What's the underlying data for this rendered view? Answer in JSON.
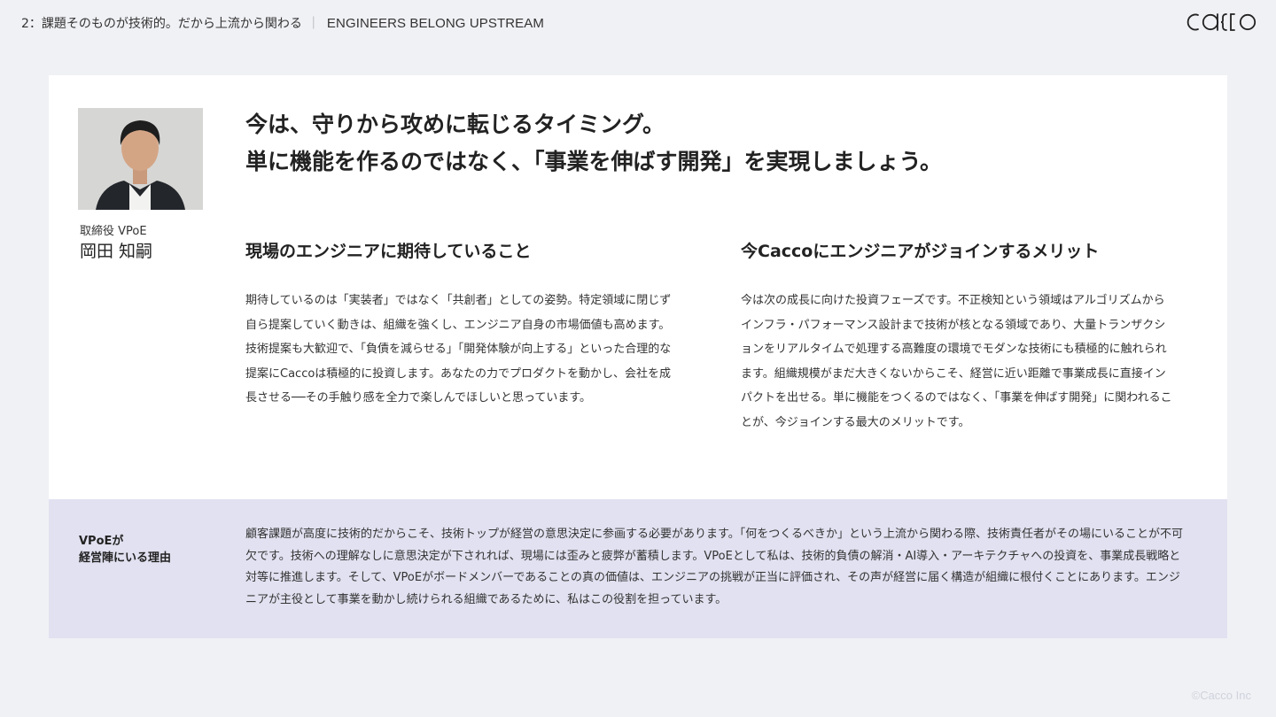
{
  "header": {
    "section": "2：課題そのものが技術的。だから上流から関わる",
    "separator": "｜",
    "section_en": "ENGINEERS BELONG UPSTREAM"
  },
  "logo": {
    "text": "cacco"
  },
  "profile": {
    "role": "取締役 VPoE",
    "name": "岡田 知嗣"
  },
  "headline": {
    "line1": "今は、守りから攻めに転じるタイミング。",
    "line2": "単に機能を作るのではなく、「事業を伸ばす開発」を実現しましょう。"
  },
  "columns": [
    {
      "title": "現場のエンジニアに期待していること",
      "body": "期待しているのは「実装者」ではなく「共創者」としての姿勢。特定領域に閉じず自ら提案していく動きは、組織を強くし、エンジニア自身の市場価値も高めます。技術提案も大歓迎で、「負債を減らせる」「開発体験が向上する」といった合理的な提案にCaccoは積極的に投資します。あなたの力でプロダクトを動かし、会社を成長させる──その手触り感を全力で楽しんでほしいと思っています。"
    },
    {
      "title": "今Caccoにエンジニアがジョインするメリット",
      "body": "今は次の成長に向けた投資フェーズです。不正検知という領域はアルゴリズムからインフラ・パフォーマンス設計まで技術が核となる領域であり、大量トランザクションをリアルタイムで処理する高難度の環境でモダンな技術にも積極的に触れられます。組織規模がまだ大きくないからこそ、経営に近い距離で事業成長に直接インパクトを出せる。単に機能をつくるのではなく、「事業を伸ばす開発」に関われることが、今ジョインする最大のメリットです。"
    }
  ],
  "band": {
    "label_line1": "VPoEが",
    "label_line2": "経営陣にいる理由",
    "body": "顧客課題が高度に技術的だからこそ、技術トップが経営の意思決定に参画する必要があります。「何をつくるべきか」という上流から関わる際、技術責任者がその場にいることが不可欠です。技術への理解なしに意思決定が下されれば、現場には歪みと疲弊が蓄積します。VPoEとして私は、技術的負債の解消・AI導入・アーキテクチャへの投資を、事業成長戦略と対等に推進します。そして、VPoEがボードメンバーであることの真の価値は、エンジニアの挑戦が正当に評価され、その声が経営に届く構造が組織に根付くことにあります。エンジニアが主役として事業を動かし続けられる組織であるために、私はこの役割を担っています。"
  },
  "footer": {
    "copyright": "©Cacco Inc"
  },
  "colors": {
    "page_bg": "#f0f1f5",
    "card_bg": "#ffffff",
    "band_bg": "#e1e1f1",
    "text": "#222222"
  }
}
